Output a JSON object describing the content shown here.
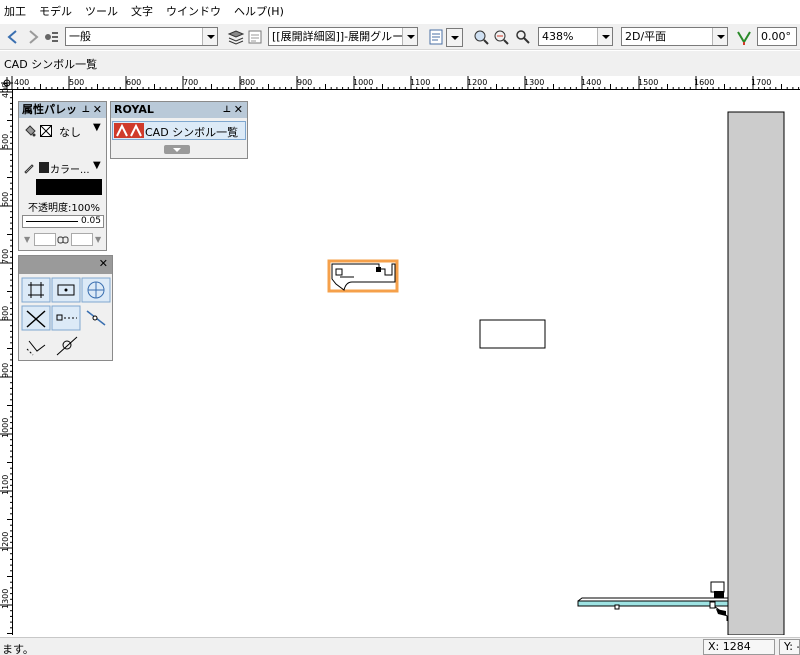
{
  "menu": [
    "加工",
    "モデル",
    "ツール",
    "文字",
    "ウインドウ",
    "ヘルプ(H)"
  ],
  "toolbar": {
    "class_value": "一般",
    "layer_value": "[[展開詳細図]]-展開グルー...",
    "zoom_value": "438%",
    "view_value": "2D/平面",
    "angle_value": "0.00°"
  },
  "window_title": "CAD シンボル一覧",
  "hruler_labels": [
    "400",
    "500",
    "600",
    "700",
    "800",
    "900",
    "1000",
    "1100",
    "1200",
    "1300",
    "1400",
    "1500",
    "1600",
    "1700"
  ],
  "vruler_labels": [
    "400",
    "500",
    "600",
    "700",
    "800",
    "900",
    "1000",
    "1100",
    "1200",
    "1300"
  ],
  "attr_palette": {
    "title": "属性パレッ",
    "fill_label": "なし",
    "pen_label": "カラー...",
    "opacity_label": "不透明度:100%",
    "line_weight": "0.05"
  },
  "royal_palette": {
    "title": "ROYAL",
    "item_label": "CAD シンボル一覧"
  },
  "status": {
    "message": "ます。",
    "x_coord": "X: 1284",
    "y_coord": "Y: -"
  },
  "colors": {
    "selection": "#f5a04a",
    "wall": "#cccccc",
    "shelf": "#9ee3e3",
    "palette_title": "#b9c9d8",
    "logo_red": "#d03a2a"
  }
}
